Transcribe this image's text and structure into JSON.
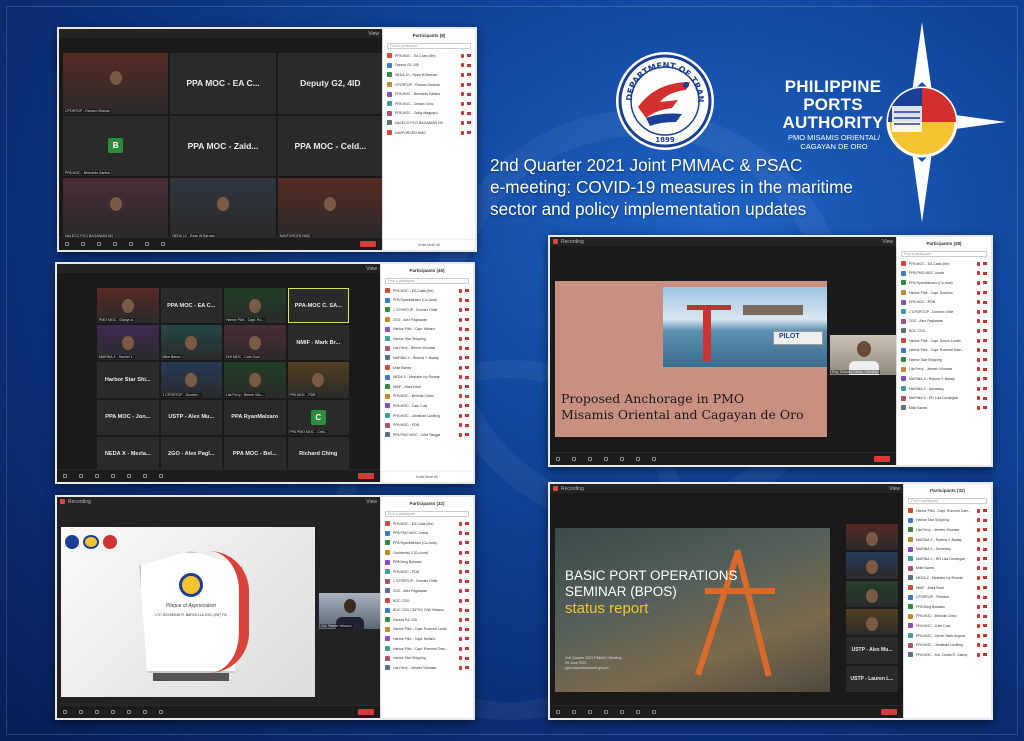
{
  "heading": {
    "line1": "2nd Quarter 2021 Joint PMMAC & PSAC",
    "line2": "e-meeting: COVID-19 measures in the maritime",
    "line3": "sector and policy implementation updates"
  },
  "ppa_logo": {
    "title_line1": "PHILIPPINE",
    "title_line2": "PORTS",
    "title_line3": "AUTHORITY",
    "sub_line1": "PMO MISAMIS ORIENTAL/",
    "sub_line2": "CAGAYAN DE ORO"
  },
  "dotr_logo": {
    "text": "DEPARTMENT OF TRANSPORTATION",
    "year": "1899"
  },
  "colors": {
    "accent_red": "#d43b3b",
    "zoom_blue": "#2d8cff",
    "mic_off": "#cc3333",
    "highlight": "#d9e35a"
  },
  "shot1": {
    "view_label": "View",
    "panel_title": "Participants (8)",
    "search_placeholder": "Find a participant",
    "tiles": [
      {
        "name": "",
        "caption": "CPORTOP - Ramon Obando"
      },
      {
        "name": "PPA MOC - EA C...",
        "caption": ""
      },
      {
        "name": "Deputy G2, 4ID",
        "caption": ""
      },
      {
        "name": "",
        "avatar": "B",
        "caption": "PPA MOC - Bernardo Santos"
      },
      {
        "name": "PPA MOC - Zald...",
        "caption": ""
      },
      {
        "name": "PPA MOC - Celd...",
        "caption": ""
      },
      {
        "name": "",
        "caption": "NALECO PCG BAGANIAN NO"
      },
      {
        "name": "",
        "caption": "NEDA 10 - Ryan W Bernas"
      },
      {
        "name": "",
        "caption": "NAVFORCEN NMO"
      }
    ],
    "participants": [
      "PPA MOC - EA Cabs (Me)",
      "Deputy G2, 4ID",
      "NEDA 10 - Ryan W Bernas",
      "CPORTOP - Ramon Obando",
      "PPA MOC - Bernardo Santos",
      "PPA MOC - Celdan Oroc",
      "PPA MOC - Zaldy Magpayo",
      "NALECO PCG BAGANIAN NO",
      "NAVFORCEN NMO"
    ],
    "footer": "Invite   Mute All"
  },
  "shot2": {
    "view_label": "View",
    "panel_title": "Participants (45)",
    "search_placeholder": "Find a participant",
    "tiles": [
      {
        "name": "",
        "caption": "PMO MOC - Gladys A."
      },
      {
        "name": "PPA MOC - EA C...",
        "caption": ""
      },
      {
        "name": "",
        "caption": "Harbor Pilot - Capt. Ro..."
      },
      {
        "name": "PPA-MOC C. SA...",
        "caption": "",
        "hl": true
      },
      {
        "name": "",
        "caption": "MARINA X - Rachel L."
      },
      {
        "name": "",
        "caption": "Mike Banez"
      },
      {
        "name": "",
        "caption": "DHI MOC - Cato Cusi"
      },
      {
        "name": "NMIF - Mark Br...",
        "caption": ""
      },
      {
        "name": "Harbor Star Shi...",
        "caption": ""
      },
      {
        "name": "",
        "caption": "1 CPORTOP - Donnex..."
      },
      {
        "name": "",
        "caption": "Lila Ferry - Renee Vilu..."
      },
      {
        "name": "",
        "caption": "PPA MOC - PDB"
      },
      {
        "name": "PPA MOC - Jon...",
        "caption": ""
      },
      {
        "name": "USTP - Alex Mu...",
        "caption": ""
      },
      {
        "name": "PPA RyanMalzaro",
        "caption": ""
      },
      {
        "name": "",
        "avatar": "C",
        "caption": "PPA PMO MOC - Celd..."
      },
      {
        "name": "NEDA X - Mezla...",
        "caption": ""
      },
      {
        "name": "2GO - Alex Pagl...",
        "caption": ""
      },
      {
        "name": "PPA MOC - Bel...",
        "caption": ""
      },
      {
        "name": "Richard Ching",
        "caption": ""
      }
    ],
    "participants": [
      "PPA MOC - EA Cabs (Me)",
      "PPA RyanMalzaro (Co-host)",
      "1 CPORTOP - Donnex Orille",
      "2GO - Alex Pagliawan",
      "Harbor Pilot - Capt. Melario",
      "Harbor Star Shipping",
      "Lila Ferry - Renee Vilumaw",
      "MARINA X - Rubina Y. Baday",
      "Mike Banez",
      "NEDA X - Mezlabe Ivy Rosete",
      "NMIF - Mark Brad",
      "PPA MOC - Belinda Cristo",
      "PPA MOC - Cato Cusi",
      "PPA MOC - Jonathan Lavilling",
      "PPA MOC - PDB",
      "PPA PMO MOC - Celd Tangga"
    ],
    "footer": "Invite   Mute All"
  },
  "shot3": {
    "recording_label": "Recording",
    "view_label": "View",
    "panel_title": "Participants (28)",
    "search_placeholder": "Find a participant",
    "slide_title_line1": "Proposed Anchorage in PMO",
    "slide_title_line2": "Misamis Oriental and Cagayan de Oro",
    "sign_label": "PILOT",
    "speaker_caption": "Eng. Richard Ching - Speaker",
    "participants": [
      "PPA MOC - EA Cabs (Me)",
      "PPA PMO MOC Leads",
      "PPA RyanMalzaro (Co-host)",
      "Harbor Pilot - Capt. Rodolos",
      "PPA MOC - PDB",
      "1 CPORTOP - Donnex Orille",
      "2GO - Alex Pagliawan",
      "BOC CDO",
      "Harbor Pilot - Capt. Simon Lunab",
      "Harbor Pilot - Capt. Rommel Dam...",
      "Harbor Star Shipping",
      "Lila Ferry - Jenees Vilumaw",
      "MARINA X - Rubina Y. Baday",
      "MARINA X - Secretary",
      "MARINA X - RD Lisa Domingan",
      "Mike Banez"
    ]
  },
  "shot4": {
    "recording_label": "Recording",
    "view_label": "View",
    "panel_title": "Participants (32)",
    "search_placeholder": "Find a participant",
    "plaque_title": "Plaque of Appreciation",
    "plaque_awardee": "LTC RAYMOND R. BARCELLA GSC (INF) PA",
    "speaker_caption": "Col. Ravier Velasco",
    "participants": [
      "PPA MOC - EA Cabs (Me)",
      "PPA PMO MOC Leads",
      "PPA RyanMalzaro (Co-host)",
      "Occidental-3 (Co-host)",
      "PPA Brng Bokatan",
      "PPA MOC - PDB",
      "1 CPORTOP - Donnex Orille",
      "2GO - Alex Pagliawan",
      "BOC CDO",
      "BOC CDO CDPCO OIW Velasco",
      "Deputy G2, 4ID",
      "Harbor Pilot - Capt. Rommel Lanth",
      "Harbor Pilot - Capt. Melario",
      "Harbor Pilot - Capt. Rommel Dam...",
      "Harbor Star Shipping",
      "Lila Ferry - Jenees Vilumaw"
    ]
  },
  "shot5": {
    "recording_label": "Recording",
    "view_label": "View",
    "panel_title": "Participants (32)",
    "search_placeholder": "Find a participant",
    "slide_line1": "BASIC PORT OPERATIONS",
    "slide_line2": "SEMINAR (BPOS)",
    "slide_line3": "status report",
    "slide_footer1": "2nd Quarter 2021 PMMAC Meeting",
    "slide_footer2": "29 June 2021",
    "slide_footer3": "ppa.misamisoriental.gov.ph",
    "video_tiles": [
      {
        "name": "",
        "caption": ""
      },
      {
        "name": "",
        "caption": ""
      },
      {
        "name": "",
        "caption": ""
      },
      {
        "name": "",
        "caption": ""
      },
      {
        "name": "USTP - Alex Mu...",
        "caption": ""
      },
      {
        "name": "USTP - Lauren L...",
        "caption": ""
      }
    ],
    "participants": [
      "Harbor Pilot - Capt. Rommel Dam...",
      "Harbor Star Shipping",
      "Lila Ferry - Jenees Vilumaw",
      "MARINA X - Rubina Y. Baday",
      "MARINA X - Secretary",
      "MARINA X - RD Lisa Domingan",
      "Mike Banez",
      "NEDA X - Mezlabe Ivy Rosete",
      "NMIF - Mark Brad",
      "CPORTOP - Pinedoe",
      "PPA Brng Bokatan",
      "PPA MOC - Belinda Cristo",
      "PPA MOC - Cato Cusi",
      "PPA MOC - Gener Mark Angcar",
      "PPA MOC - Jonathan Lavilling",
      "PPA MOC - Ma. Cristia R. Gabuy"
    ]
  }
}
